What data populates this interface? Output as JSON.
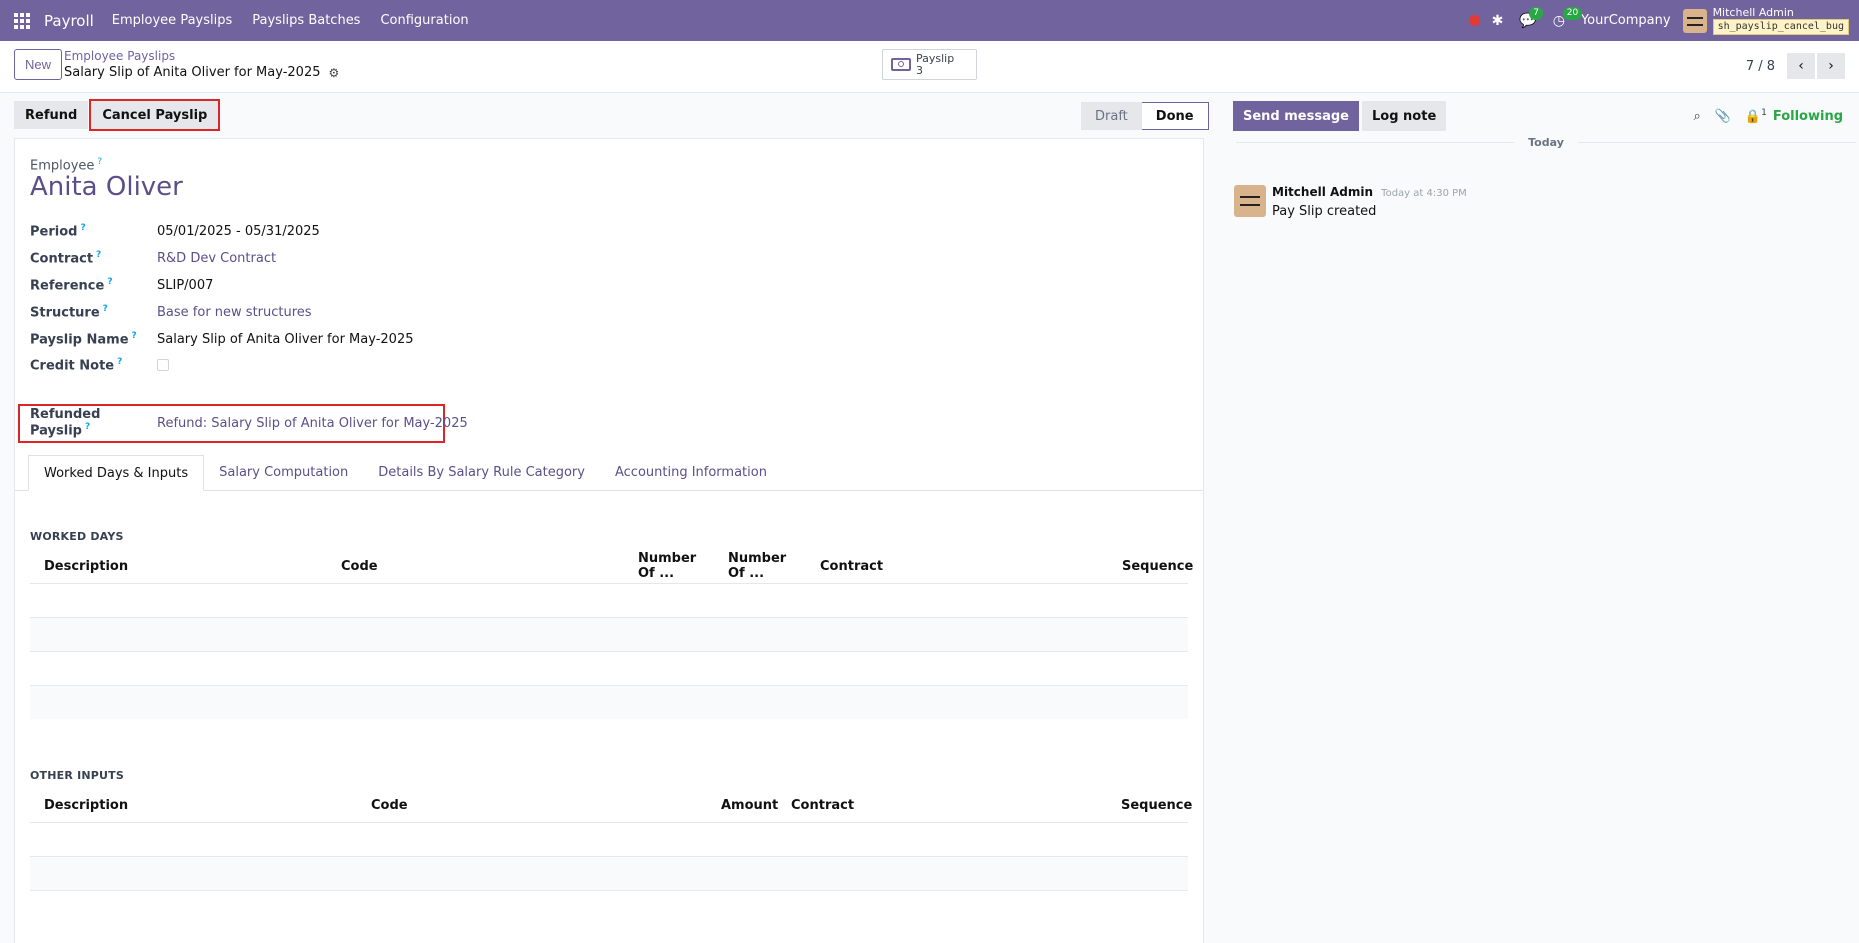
{
  "navbar": {
    "app_name": "Payroll",
    "menu": [
      "Employee Payslips",
      "Payslips Batches",
      "Configuration"
    ],
    "messages_count": "7",
    "activities_count": "20",
    "company": "YourCompany",
    "user_name": "Mitchell Admin",
    "db_name": "sh_payslip_cancel_bug"
  },
  "control_panel": {
    "new_label": "New",
    "breadcrumb_parent": "Employee Payslips",
    "breadcrumb_current": "Salary Slip of Anita Oliver for May-2025",
    "smart_button": {
      "label": "Payslip",
      "count": "3"
    },
    "pager": "7 / 8"
  },
  "statusbar": {
    "refund_label": "Refund",
    "cancel_label": "Cancel Payslip",
    "stages": [
      "Draft",
      "Done"
    ],
    "active_stage": "Done"
  },
  "form": {
    "employee_label": "Employee",
    "employee_name": "Anita Oliver",
    "fields": [
      {
        "label": "Period",
        "value": "05/01/2025 - 05/31/2025"
      },
      {
        "label": "Contract",
        "value": "R&D Dev Contract"
      },
      {
        "label": "Reference",
        "value": "SLIP/007"
      },
      {
        "label": "Structure",
        "value": "Base for new structures"
      },
      {
        "label": "Payslip Name",
        "value": "Salary Slip of Anita Oliver for May-2025"
      },
      {
        "label": "Credit Note",
        "value": ""
      },
      {
        "label": "Refunded Payslip",
        "value": "Refund: Salary Slip of Anita Oliver for May-2025"
      }
    ],
    "help_mark": "?"
  },
  "tabs": [
    "Worked Days & Inputs",
    "Salary Computation",
    "Details By Salary Rule Category",
    "Accounting Information"
  ],
  "worked_days": {
    "title": "WORKED DAYS",
    "columns": [
      "Description",
      "Code",
      "Number Of ...",
      "Number Of ...",
      "Contract",
      "Sequence"
    ]
  },
  "other_inputs": {
    "title": "OTHER INPUTS",
    "columns": [
      "Description",
      "Code",
      "Amount",
      "Contract",
      "Sequence"
    ]
  },
  "chatter": {
    "send_message": "Send message",
    "log_note": "Log note",
    "followers_count": "1",
    "following": "Following",
    "date_separator": "Today",
    "message": {
      "author": "Mitchell Admin",
      "date": "Today at 4:30 PM",
      "body": "Pay Slip created"
    }
  }
}
